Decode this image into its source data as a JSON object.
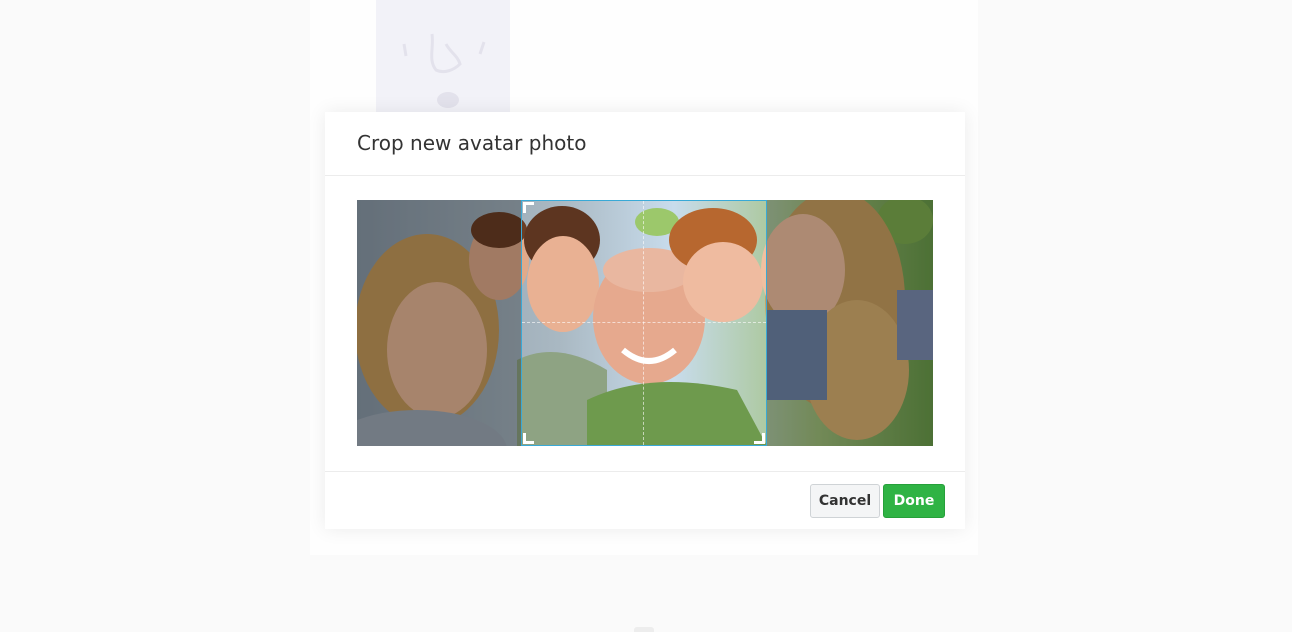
{
  "modal": {
    "title": "Crop new avatar photo",
    "cancel_label": "Cancel",
    "done_label": "Done"
  },
  "photo": {
    "description_icon": "family-photo"
  },
  "colors": {
    "crop_border": "#39a9d6",
    "done_button": "#2fb344",
    "cancel_button": "#f4f5f6"
  }
}
